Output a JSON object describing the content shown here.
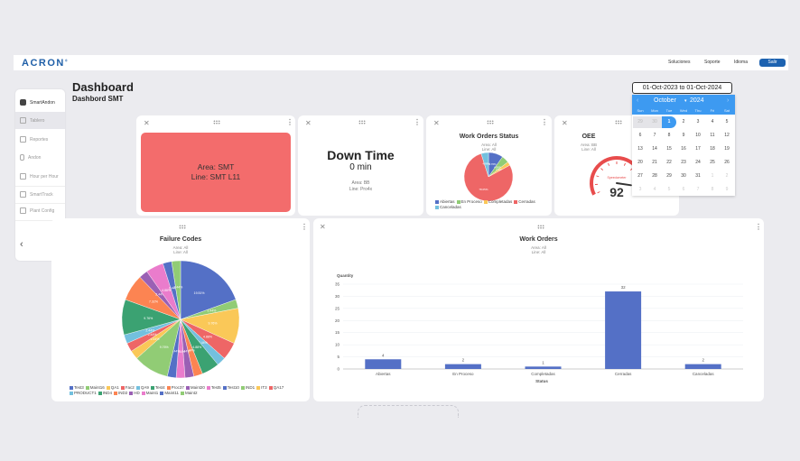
{
  "topnav": {
    "logo": "ACRON",
    "links": [
      "Soluciones",
      "Soporte",
      "Idioma"
    ],
    "logout_label": "Salir"
  },
  "header": {
    "title": "Dashboard",
    "subtitle": "Dashbord SMT"
  },
  "sidebar": {
    "items": [
      {
        "label": "SmartAndon",
        "icon": "layers-icon"
      },
      {
        "label": "Tablero",
        "icon": "bar-chart-icon",
        "active": true
      },
      {
        "label": "Reportes",
        "icon": "table-icon"
      },
      {
        "label": "Andon",
        "icon": "andon-light-icon"
      },
      {
        "label": "Hour per Hour",
        "icon": "calendar-icon"
      },
      {
        "label": "SmartTrack",
        "icon": "network-icon"
      },
      {
        "label": "Plant Config",
        "icon": "plant-config-icon"
      }
    ],
    "collapse_icon": "chevron-left-icon"
  },
  "date_picker": {
    "range_text": "01-Oct-2023 to 01-Oct-2024",
    "month": "October",
    "year": "2024",
    "weekdays": [
      "Sun",
      "Mon",
      "Tue",
      "Wed",
      "Thu",
      "Fri",
      "Sat"
    ],
    "weeks": [
      [
        "29",
        "30",
        "1",
        "2",
        "3",
        "4",
        "5"
      ],
      [
        "6",
        "7",
        "8",
        "9",
        "10",
        "11",
        "12"
      ],
      [
        "13",
        "14",
        "15",
        "16",
        "17",
        "18",
        "19"
      ],
      [
        "20",
        "21",
        "22",
        "23",
        "24",
        "25",
        "26"
      ],
      [
        "27",
        "28",
        "29",
        "30",
        "31",
        "1",
        "2"
      ],
      [
        "3",
        "4",
        "5",
        "6",
        "7",
        "8",
        "9"
      ]
    ],
    "selected_day": "1"
  },
  "widgets": {
    "andon": {
      "area": "Area: SMT",
      "line": "Line: SMT L11",
      "status_color": "#f36c6c"
    },
    "downtime": {
      "title": "Down Time",
      "value": "0 min",
      "area": "Area: BB",
      "line": "Line: Pro4x"
    },
    "wo_status": {
      "title": "Work Orders Status",
      "area": "Area: All",
      "line": "Line: All"
    },
    "oee": {
      "title": "OEE",
      "area": "Area: BB",
      "line": "Line: All",
      "value": "92",
      "gauge_label": "Speedometer"
    },
    "failure_codes": {
      "title": "Failure Codes",
      "area": "Area: All",
      "line": "Line: All"
    },
    "work_orders": {
      "title": "Work Orders",
      "area": "Area: All",
      "line": "Line: All"
    }
  },
  "chart_data": [
    {
      "type": "pie",
      "title": "Work Orders Status",
      "categories": [
        "Abiertas",
        "En Proceso",
        "Completadas",
        "Cerradas",
        "Canceladas"
      ],
      "values": [
        4,
        2,
        1,
        32,
        2
      ],
      "labels": [
        "9.76%",
        "4.88%",
        "2.44%",
        "78.05%",
        "4.88%"
      ],
      "colors": [
        "#5470c6",
        "#91cc75",
        "#fac858",
        "#ee6666",
        "#73c0de"
      ],
      "legend": "bottom"
    },
    {
      "type": "pie",
      "title": "Failure Codes",
      "categories": [
        "Test3",
        "Maint16",
        "QA1",
        "Fac2",
        "QA9",
        "Test4",
        "Proc37",
        "Maint20",
        "Test5",
        "Test10",
        "IND1",
        "IT3",
        "QA17",
        "PRODUCT1",
        "IND4",
        "IND2",
        "HD",
        "Maint1",
        "Maint11",
        "Maint2"
      ],
      "values": [
        8,
        1,
        4,
        2,
        1,
        2,
        1,
        1,
        1,
        1,
        4,
        1,
        1,
        1,
        4,
        3,
        1,
        2,
        1,
        1
      ],
      "labels": [
        "19.51%",
        "2.44%",
        "9.76%",
        "4.88%",
        "2.44%",
        "4.88%",
        "2.44%",
        "2.44%",
        "2.44%",
        "2.44%",
        "9.76%",
        "2.44%",
        "2.44%",
        "2.44%",
        "9.76%",
        "7.32%",
        "2.44%",
        "4.88%",
        "2.44%",
        "2.44%"
      ],
      "colors": [
        "#5470c6",
        "#91cc75",
        "#fac858",
        "#ee6666",
        "#73c0de",
        "#3ba272",
        "#fc8452",
        "#9a60b4",
        "#ea7ccc",
        "#5470c6",
        "#91cc75",
        "#fac858",
        "#ee6666",
        "#73c0de",
        "#3ba272",
        "#fc8452",
        "#9a60b4",
        "#ea7ccc",
        "#5470c6",
        "#91cc75"
      ],
      "legend": "bottom"
    },
    {
      "type": "bar",
      "title": "Work Orders",
      "categories": [
        "Abiertas",
        "En Proceso",
        "Completadas",
        "Cerradas",
        "Canceladas"
      ],
      "values": [
        4,
        2,
        1,
        32,
        2
      ],
      "xlabel": "Status",
      "ylabel": "Quantity",
      "ylim": [
        0,
        35
      ],
      "yticks": [
        0,
        5,
        10,
        15,
        20,
        25,
        30,
        35
      ],
      "grid": true,
      "color": "#5470c6"
    },
    {
      "type": "gauge",
      "title": "OEE",
      "value": 92,
      "range": [
        0,
        100
      ]
    }
  ]
}
